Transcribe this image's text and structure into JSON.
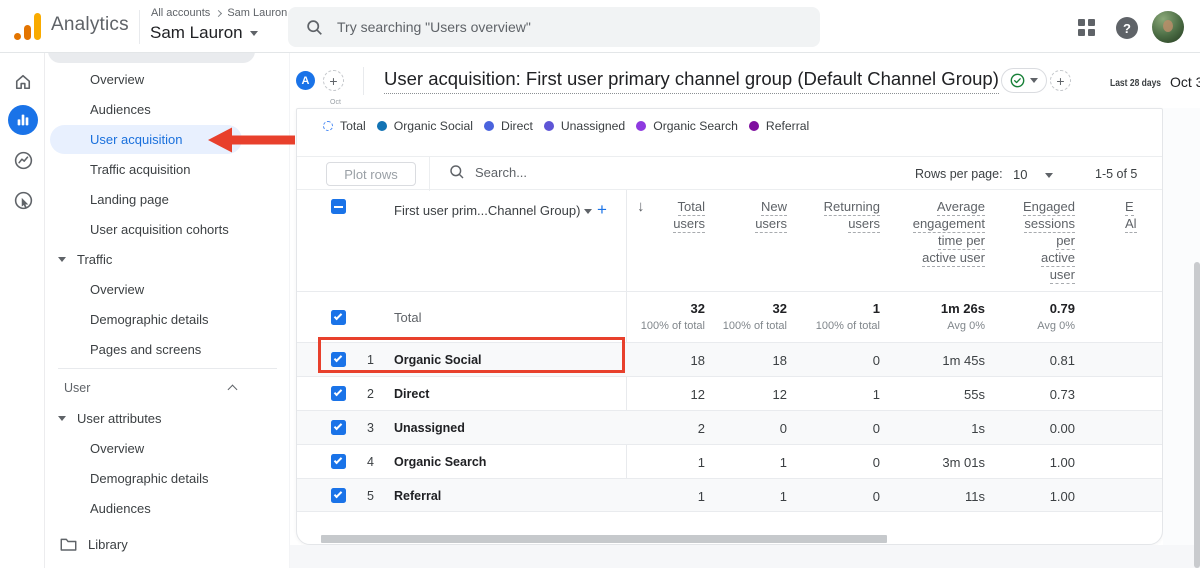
{
  "topbar": {
    "brand": "Analytics",
    "breadcrumb_root": "All accounts",
    "breadcrumb_user": "Sam Lauron",
    "account_name": "Sam Lauron",
    "search_placeholder": "Try searching \"Users overview\""
  },
  "nav": {
    "items": [
      {
        "label": "Overview"
      },
      {
        "label": "Audiences"
      },
      {
        "label": "User acquisition",
        "selected": true
      },
      {
        "label": "Traffic acquisition"
      },
      {
        "label": "Landing page"
      },
      {
        "label": "User acquisition cohorts"
      },
      {
        "label": "Traffic",
        "type": "group"
      },
      {
        "label": "Overview"
      },
      {
        "label": "Demographic details"
      },
      {
        "label": "Pages and screens"
      },
      {
        "label": "User",
        "type": "section"
      },
      {
        "label": "User attributes",
        "type": "group"
      },
      {
        "label": "Overview"
      },
      {
        "label": "Demographic details"
      },
      {
        "label": "Audiences"
      },
      {
        "label": "Library",
        "type": "root"
      }
    ]
  },
  "report": {
    "avatar_letter": "A",
    "title": "User acquisition: First user primary channel group (Default Channel Group)",
    "date_range_label": "Last 28 days",
    "date_range_value": "Oct 3",
    "axis_fragment": "Oct"
  },
  "legend": {
    "items": [
      {
        "label": "Total",
        "color": "#4285f4",
        "style": "dashed"
      },
      {
        "label": "Organic Social",
        "color": "#1273b4"
      },
      {
        "label": "Direct",
        "color": "#4a63dd"
      },
      {
        "label": "Unassigned",
        "color": "#5e55d6"
      },
      {
        "label": "Organic Search",
        "color": "#8e3ae0"
      },
      {
        "label": "Referral",
        "color": "#7e0f9f"
      }
    ]
  },
  "toolbar": {
    "plot_rows_label": "Plot rows",
    "search_placeholder": "Search...",
    "rows_per_page_label": "Rows per page:",
    "rows_per_page_value": "10",
    "range_label": "1-5 of 5"
  },
  "table": {
    "dimension_header": "First user prim...Channel Group)",
    "sort_arrow": "↓",
    "columns": [
      {
        "lines": [
          "Total",
          "users"
        ]
      },
      {
        "lines": [
          "New",
          "users"
        ]
      },
      {
        "lines": [
          "Returning",
          "users"
        ]
      },
      {
        "lines": [
          "Average",
          "engagement",
          "time per",
          "active user"
        ]
      },
      {
        "lines": [
          "Engaged",
          "sessions",
          "per",
          "active",
          "user"
        ]
      }
    ],
    "clipped_column": {
      "line1": "E",
      "line2": "Al"
    },
    "totals": {
      "label": "Total",
      "values": [
        "32",
        "32",
        "1",
        "1m 26s",
        "0.79"
      ],
      "subs": [
        "100% of total",
        "100% of total",
        "100% of total",
        "Avg 0%",
        "Avg 0%"
      ]
    },
    "rows": [
      {
        "num": "1",
        "channel": "Organic Social",
        "values": [
          "18",
          "18",
          "0",
          "1m 45s",
          "0.81"
        ]
      },
      {
        "num": "2",
        "channel": "Direct",
        "values": [
          "12",
          "12",
          "1",
          "55s",
          "0.73"
        ]
      },
      {
        "num": "3",
        "channel": "Unassigned",
        "values": [
          "2",
          "0",
          "0",
          "1s",
          "0.00"
        ]
      },
      {
        "num": "4",
        "channel": "Organic Search",
        "values": [
          "1",
          "1",
          "0",
          "3m 01s",
          "1.00"
        ]
      },
      {
        "num": "5",
        "channel": "Referral",
        "values": [
          "1",
          "1",
          "0",
          "11s",
          "1.00"
        ]
      }
    ]
  }
}
